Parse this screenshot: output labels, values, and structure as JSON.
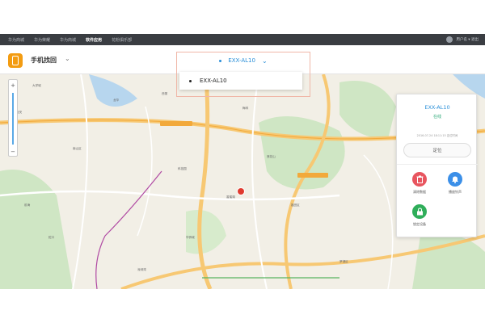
{
  "topnav": {
    "items": [
      {
        "label": "华为商城"
      },
      {
        "label": "华为荣耀"
      },
      {
        "label": "华为商城"
      },
      {
        "label": "软件应用"
      },
      {
        "label": "花粉俱乐部"
      }
    ],
    "user_label": "用户名 ▾ 退出"
  },
  "app": {
    "title": "手机找回",
    "chevron_icon": "chevron-down-icon"
  },
  "device_selector": {
    "selected": "EXX-AL10",
    "options": [
      {
        "label": "EXX-AL10"
      }
    ]
  },
  "map": {
    "places": [
      "大学城",
      "西丽",
      "南山区",
      "科技园",
      "福田区",
      "深圳湾",
      "华侨城",
      "蛇口",
      "前海",
      "宝安",
      "罗湖区",
      "梅林",
      "龙华",
      "莲花山",
      "香蜜湖"
    ]
  },
  "device_panel": {
    "name": "EXX-AL10",
    "status": "在线",
    "meta": "2016-07-24 18:11:15 定位时间",
    "locate_label": "定位",
    "actions": [
      {
        "label": "清除数据",
        "icon": "trash-icon",
        "color": "#e8555f"
      },
      {
        "label": "播放铃声",
        "icon": "bell-icon",
        "color": "#3b8fe8"
      },
      {
        "label": "锁定设备",
        "icon": "lock-icon",
        "color": "#2fae5a"
      }
    ]
  }
}
